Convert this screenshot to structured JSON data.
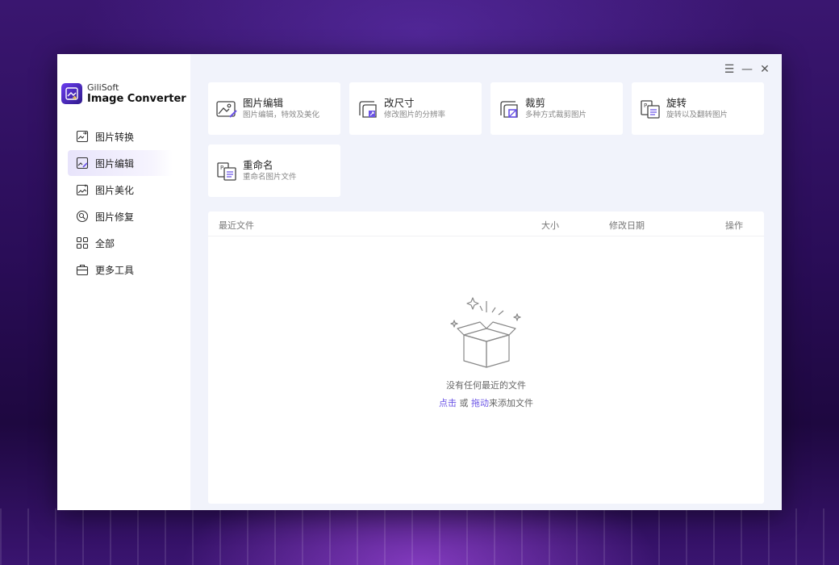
{
  "app": {
    "brand_small": "GiliSoft",
    "brand_big": "Image Converter"
  },
  "sidebar": {
    "items": [
      {
        "label": "图片转换",
        "icon": "image-convert-icon"
      },
      {
        "label": "图片编辑",
        "icon": "image-edit-icon",
        "active": true
      },
      {
        "label": "图片美化",
        "icon": "image-beautify-icon"
      },
      {
        "label": "图片修复",
        "icon": "image-repair-icon"
      },
      {
        "label": "全部",
        "icon": "grid-icon"
      },
      {
        "label": "更多工具",
        "icon": "toolbox-icon"
      }
    ]
  },
  "window_controls": {
    "menu": "☰",
    "minimize": "—",
    "close": "✕"
  },
  "tools": [
    {
      "title": "图片编辑",
      "desc": "图片编辑，特效及美化",
      "icon": "image-edit-icon"
    },
    {
      "title": "改尺寸",
      "desc": "修改图片的分辨率",
      "icon": "resize-icon"
    },
    {
      "title": "裁剪",
      "desc": "多种方式裁剪图片",
      "icon": "crop-icon"
    },
    {
      "title": "旋转",
      "desc": "旋转以及翻转图片",
      "icon": "rotate-icon"
    },
    {
      "title": "重命名",
      "desc": "重命名图片文件",
      "icon": "rename-icon"
    }
  ],
  "files": {
    "columns": {
      "name": "最近文件",
      "size": "大小",
      "date": "修改日期",
      "action": "操作"
    },
    "empty": {
      "message": "没有任何最近的文件",
      "click": "点击",
      "or": "或",
      "drag": "拖动",
      "suffix": "来添加文件"
    }
  },
  "colors": {
    "accent": "#6b54e6",
    "window_bg": "#f1f3fb"
  }
}
